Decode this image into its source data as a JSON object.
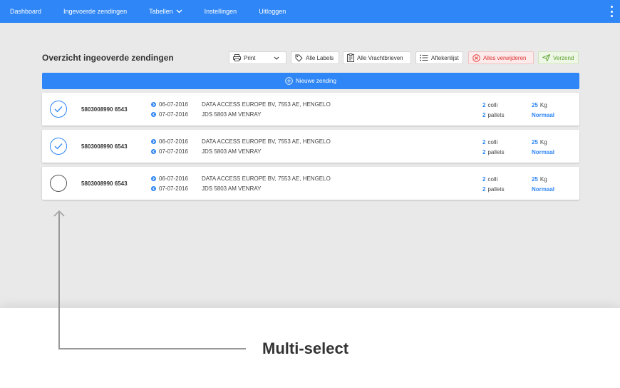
{
  "nav": {
    "items": [
      {
        "label": "Dashboard"
      },
      {
        "label": "Ingevoerde zendingen"
      },
      {
        "label": "Tabellen"
      },
      {
        "label": "Instellingen"
      },
      {
        "label": "Uitloggen"
      }
    ],
    "more_icon": "kebab-vertical-icon",
    "background": "#2f86f6"
  },
  "toolbar": {
    "title": "Overzicht ingeoverde zendingen",
    "print_label": "Print",
    "labels_label": "Alle Labels",
    "vrachtbrieven_label": "Alle Vrachtbrieven",
    "aftekenlijst_label": "Aftekenlijst",
    "delete_label": "Alles verwijderen",
    "verzend_label": "Verzend"
  },
  "new_button": {
    "label": "Nieuwe zending"
  },
  "shipments": [
    {
      "selected": true,
      "id": "5803008990 6543",
      "send_date": "06-07-2016",
      "sender": "DATA ACCESS EUROPE BV, 7553 AE, HENGELO",
      "deliver_date": "07-07-2016",
      "receiver": "JDS 5803 AM VENRAY",
      "colli_count": "2",
      "colli_unit": "colli",
      "pallet_count": "2",
      "pallet_unit": "pallets",
      "weight": "25",
      "weight_unit": "Kg",
      "service": "Normaal"
    },
    {
      "selected": true,
      "id": "5803008990 6543",
      "send_date": "06-07-2016",
      "sender": "DATA ACCESS EUROPE BV, 7553 AE, HENGELO",
      "deliver_date": "07-07-2016",
      "receiver": "JDS 5803 AM VENRAY",
      "colli_count": "2",
      "colli_unit": "colli",
      "pallet_count": "2",
      "pallet_unit": "pallets",
      "weight": "25",
      "weight_unit": "Kg",
      "service": "Normaal"
    },
    {
      "selected": false,
      "id": "5803008990 6543",
      "send_date": "06-07-2016",
      "sender": "DATA ACCESS EUROPE BV, 7553 AE, HENGELO",
      "deliver_date": "07-07-2016",
      "receiver": "JDS 5803 AM VENRAY",
      "colli_count": "2",
      "colli_unit": "colli",
      "pallet_count": "2",
      "pallet_unit": "pallets",
      "weight": "25",
      "weight_unit": "Kg",
      "service": "Normaal"
    }
  ],
  "annotation": {
    "label": "Multi-select"
  },
  "colors": {
    "accent": "#2f86f6",
    "danger": "#d33333",
    "success": "#5aa02c"
  }
}
